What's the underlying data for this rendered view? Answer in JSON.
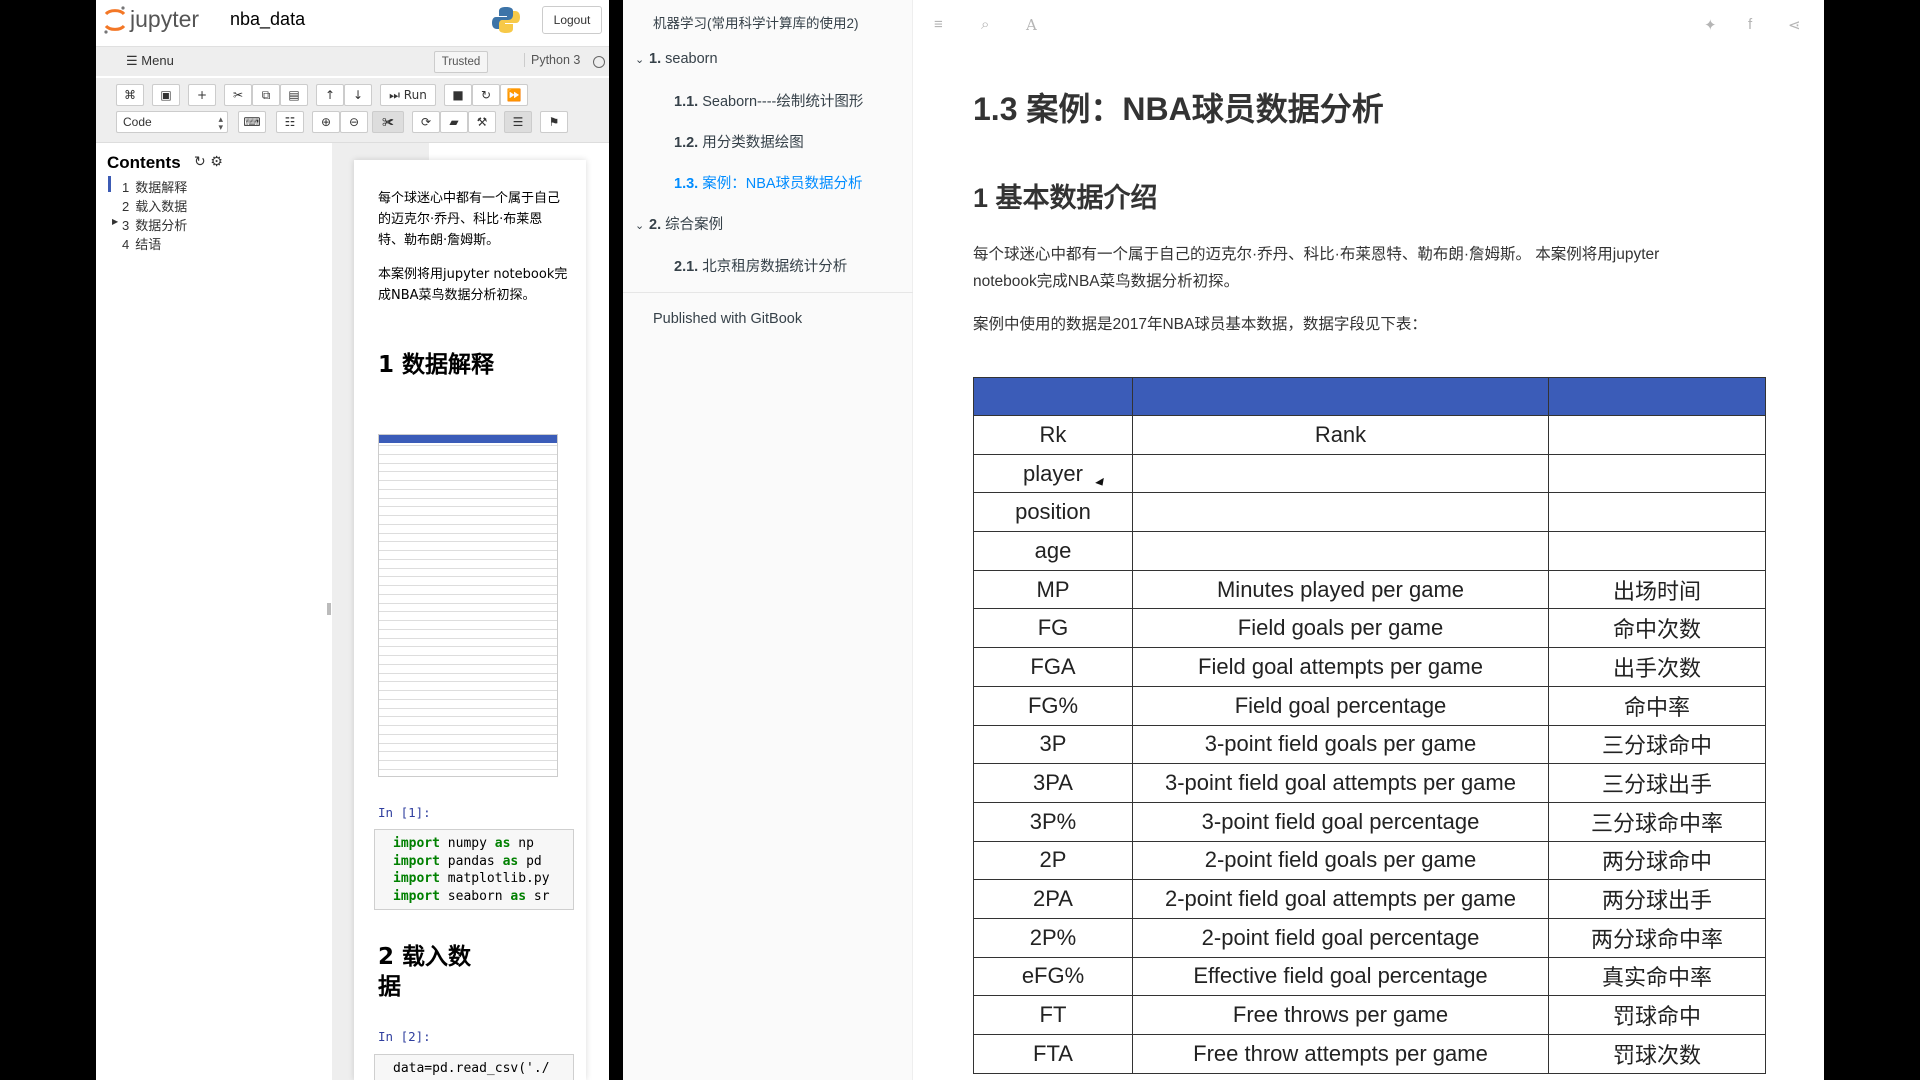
{
  "jupyter": {
    "brand": "jupyter",
    "notebook_name": "nba_data",
    "logout_label": "Logout",
    "menu_label": "Menu",
    "trusted_label": "Trusted",
    "kernel_label": "Python 3",
    "toolbar": {
      "run_label": "Run",
      "cell_type": "Code"
    },
    "toc": {
      "title": "Contents",
      "items": [
        {
          "num": "1",
          "label": "数据解释"
        },
        {
          "num": "2",
          "label": "载入数据"
        },
        {
          "num": "3",
          "label": "数据分析"
        },
        {
          "num": "4",
          "label": "结语"
        }
      ]
    },
    "notebook": {
      "para1": "每个球迷心中都有一个属于自己的迈克尔·乔丹、科比·布莱恩特、勒布朗·詹姆斯。",
      "para2": "本案例将用jupyter notebook完成NBA菜鸟数据分析初探。",
      "heading1": "1  数据解释",
      "prompt1": "In [1]:",
      "code1": [
        {
          "kw": "import",
          "rest": " numpy ",
          "kw2": "as",
          "rest2": " np"
        },
        {
          "kw": "import",
          "rest": " pandas ",
          "kw2": "as",
          "rest2": " pd"
        },
        {
          "kw": "import",
          "rest": " matplotlib.py",
          "kw2": "",
          "rest2": ""
        },
        {
          "kw": "import",
          "rest": " seaborn ",
          "kw2": "as",
          "rest2": " sr"
        }
      ],
      "heading2_line1": "2  载入数",
      "heading2_line2": "据",
      "prompt2": "In [2]:",
      "code2": "data=pd.read_csv('./"
    }
  },
  "gitbook_sidebar": {
    "book_title": "机器学习(常用科学计算库的使用2)",
    "items": [
      {
        "num": "1.",
        "label": "seaborn",
        "level": 1
      },
      {
        "num": "1.1.",
        "label": "Seaborn----绘制统计图形",
        "level": 2
      },
      {
        "num": "1.2.",
        "label": "用分类数据绘图",
        "level": 2
      },
      {
        "num": "1.3.",
        "label": "案例：NBA球员数据分析",
        "level": 2
      },
      {
        "num": "2.",
        "label": "综合案例",
        "level": 1
      },
      {
        "num": "2.1.",
        "label": "北京租房数据统计分析",
        "level": 2
      }
    ],
    "published": "Published with GitBook"
  },
  "gitbook_content": {
    "title": "1.3 案例：NBA球员数据分析",
    "subtitle": "1 基本数据介绍",
    "para1_line1": "每个球迷心中都有一个属于自己的迈克尔·乔丹、科比·布莱恩特、勒布朗·詹姆斯。 本案例将用jupyter",
    "para1_line2": "notebook完成NBA菜鸟数据分析初探。",
    "para2": "案例中使用的数据是2017年NBA球员基本数据，数据字段见下表：",
    "table": {
      "rows": [
        [
          "Rk",
          "Rank",
          ""
        ],
        [
          "player",
          "",
          ""
        ],
        [
          "position",
          "",
          ""
        ],
        [
          "age",
          "",
          ""
        ],
        [
          "MP",
          "Minutes played per game",
          "出场时间"
        ],
        [
          "FG",
          "Field goals per game",
          "命中次数"
        ],
        [
          "FGA",
          "Field goal attempts per game",
          "出手次数"
        ],
        [
          "FG%",
          "Field goal percentage",
          "命中率"
        ],
        [
          "3P",
          "3-point field goals per game",
          "三分球命中"
        ],
        [
          "3PA",
          "3-point field goal attempts per game",
          "三分球出手"
        ],
        [
          "3P%",
          "3-point field goal percentage",
          "三分球命中率"
        ],
        [
          "2P",
          "2-point field goals per game",
          "两分球命中"
        ],
        [
          "2PA",
          "2-point field goal attempts per game",
          "两分球出手"
        ],
        [
          "2P%",
          "2-point field goal percentage",
          "两分球命中率"
        ],
        [
          "eFG%",
          "Effective field goal percentage",
          "真实命中率"
        ],
        [
          "FT",
          "Free throws per game",
          "罚球命中"
        ],
        [
          "FTA",
          "Free throw attempts per game",
          "罚球次数"
        ]
      ]
    }
  },
  "colors": {
    "table_header": "#3b5cb8",
    "active_link": "#008cff",
    "prompt": "#303f9f",
    "keyword": "#008000"
  }
}
